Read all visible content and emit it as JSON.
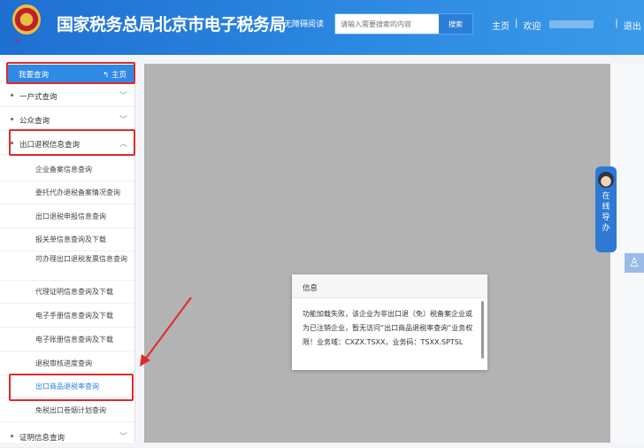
{
  "header": {
    "title": "国家税务总局北京市电子税务局",
    "accessibility": "无障碍阅读",
    "search_placeholder": "请输入需要搜索的内容",
    "search_button": "搜索",
    "home": "主页",
    "welcome": "欢迎",
    "logout": "退出",
    "separator": "|"
  },
  "sidebar": {
    "head_label": "我要查询",
    "home_label": "主页",
    "items": [
      {
        "label": "一户式查询"
      },
      {
        "label": "公众查询"
      },
      {
        "label": "出口退税信息查询"
      }
    ],
    "subitems": [
      "企业备案信息查询",
      "委托代办退税备案情况查询",
      "出口退税申报信息查询",
      "报关单信息查询及下载",
      "可办理出口退税发票信息查询",
      "代理证明信息查询及下载",
      "电子手册信息查询及下载",
      "电子账册信息查询及下载",
      "退税审核进度查询",
      "出口商品退税率查询",
      "免税出口卷烟计划查询"
    ],
    "last_item": "证明信息查询"
  },
  "dialog": {
    "title": "信息",
    "message": "功能加载失败，该企业为非出口退（免）税备案企业或为已注销企业，暂无访问“出口商品退税率查询”业务权限！业务域：CXZX.TSXX，业务码：TSXX.SPTSL"
  },
  "guide": {
    "label": "在线导办"
  },
  "colors": {
    "header": "#2a86e0",
    "highlight": "#e02a2a",
    "active": "#2a7fd9"
  }
}
